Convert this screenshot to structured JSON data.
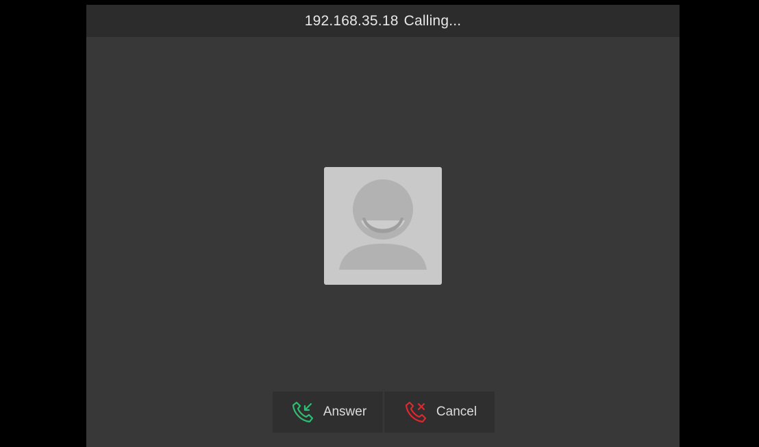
{
  "call": {
    "caller": "192.168.35.18",
    "status": "Calling..."
  },
  "avatar": {
    "icon": "person-placeholder-icon"
  },
  "actions": {
    "answer": {
      "label": "Answer",
      "icon": "phone-incoming-icon",
      "color": "#2fbf71"
    },
    "cancel": {
      "label": "Cancel",
      "icon": "phone-decline-icon",
      "color": "#e0282e"
    }
  },
  "colors": {
    "background": "#383838",
    "letterbox": "#000000",
    "avatar_bg": "#c9c9c9",
    "avatar_fg": "#b0b0b0"
  }
}
